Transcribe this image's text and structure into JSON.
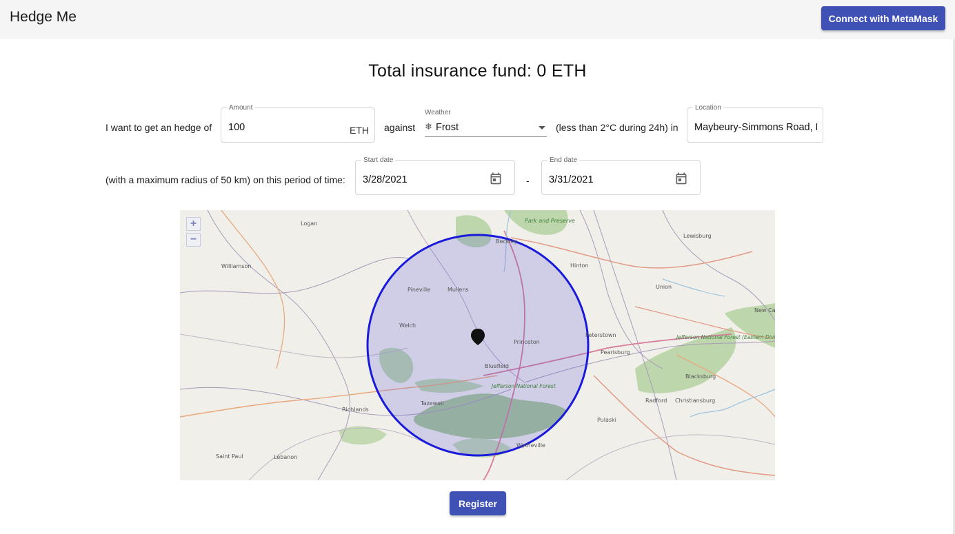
{
  "app": {
    "title": "Hedge Me",
    "connect_label": "Connect with MetaMask"
  },
  "fund": {
    "text": "Total insurance fund: 0 ETH"
  },
  "form": {
    "intro": "I want to get an hedge of",
    "amount_label": "Amount",
    "amount_value": "100",
    "amount_unit": "ETH",
    "against": "against",
    "weather_label": "Weather",
    "weather_icon": "snowflake-icon",
    "weather_value": "Frost",
    "condition": "(less than 2°C during 24h) in",
    "location_label": "Location",
    "location_value": "Maybeury-Simmons Road, Maybeury",
    "radius_text": "(with a maximum radius of 50 km) on this period of time:",
    "start_label": "Start date",
    "start_value": "3/28/2021",
    "separator": "-",
    "end_label": "End date",
    "end_value": "3/31/2021"
  },
  "map": {
    "zoom_in": "+",
    "zoom_out": "−",
    "marker_icon": "map-pin-icon",
    "circle_color": "#1a1adb",
    "places": [
      {
        "name": "Logan"
      },
      {
        "name": "Williamson"
      },
      {
        "name": "Beckley"
      },
      {
        "name": "Lewisburg"
      },
      {
        "name": "Hinton"
      },
      {
        "name": "Park and Preserve"
      },
      {
        "name": "Pineville"
      },
      {
        "name": "Mullens"
      },
      {
        "name": "Union"
      },
      {
        "name": "Welch"
      },
      {
        "name": "Princeton"
      },
      {
        "name": "Peterstown"
      },
      {
        "name": "Pearisburg"
      },
      {
        "name": "New Castle"
      },
      {
        "name": "Bluefield"
      },
      {
        "name": "Jefferson National Forest"
      },
      {
        "name": "Jefferson National Forest (Eastern Divide district)"
      },
      {
        "name": "Blacksburg"
      },
      {
        "name": "Tazewell"
      },
      {
        "name": "Radford"
      },
      {
        "name": "Christiansburg"
      },
      {
        "name": "Richlands"
      },
      {
        "name": "Pulaski"
      },
      {
        "name": "Saint Paul"
      },
      {
        "name": "Lebanon"
      },
      {
        "name": "Wytheville"
      }
    ]
  },
  "register_label": "Register"
}
